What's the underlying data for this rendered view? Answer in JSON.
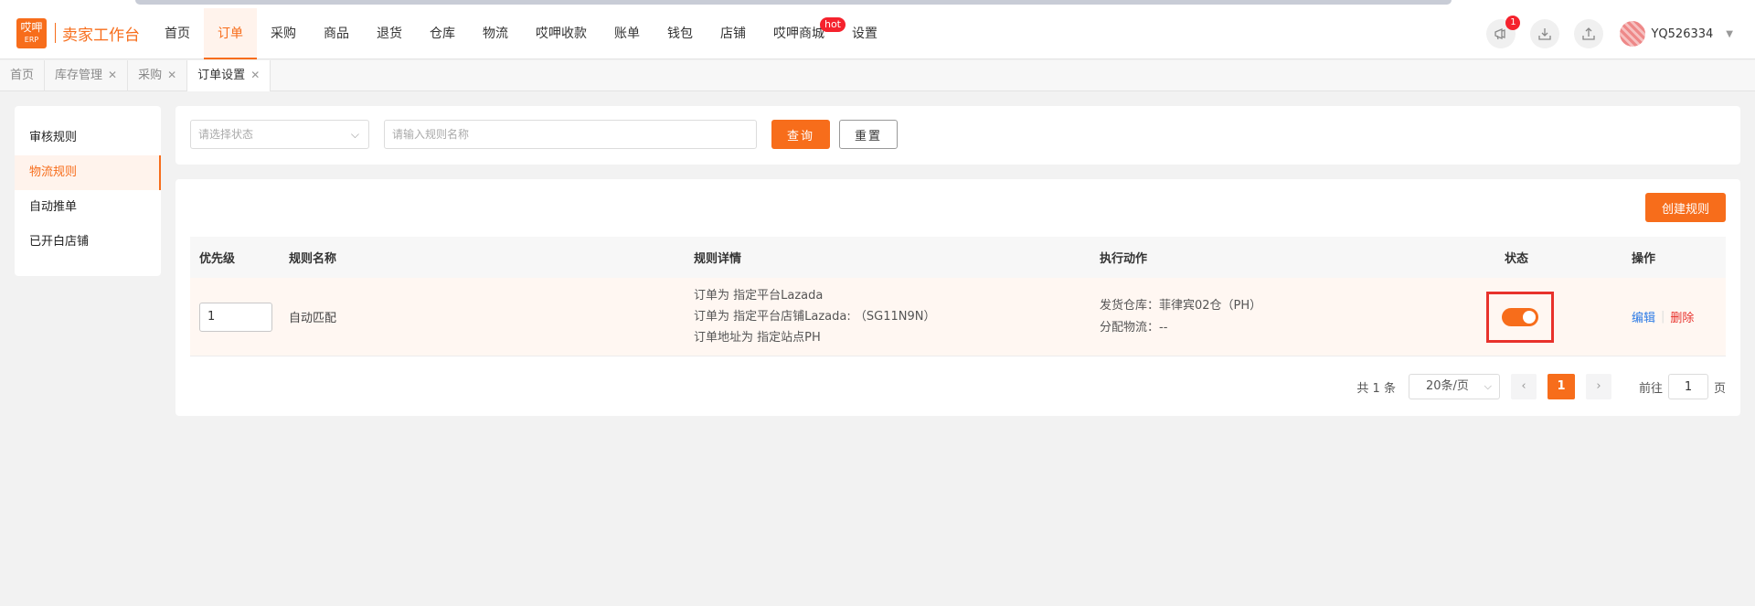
{
  "header": {
    "logo": {
      "line1": "哎呷",
      "line2": "ERP"
    },
    "app_name": "卖家工作台",
    "nav": [
      {
        "label": "首页",
        "active": false
      },
      {
        "label": "订单",
        "active": true
      },
      {
        "label": "采购",
        "active": false
      },
      {
        "label": "商品",
        "active": false
      },
      {
        "label": "退货",
        "active": false
      },
      {
        "label": "仓库",
        "active": false
      },
      {
        "label": "物流",
        "active": false
      },
      {
        "label": "哎呷收款",
        "active": false
      },
      {
        "label": "账单",
        "active": false
      },
      {
        "label": "钱包",
        "active": false
      },
      {
        "label": "店铺",
        "active": false
      },
      {
        "label": "哎呷商城",
        "active": false,
        "badge": "hot"
      },
      {
        "label": "设置",
        "active": false
      }
    ],
    "notification_count": "1",
    "username": "YQ526334",
    "icons": [
      "megaphone-icon",
      "download-icon",
      "upload-icon"
    ]
  },
  "tabs": [
    {
      "label": "首页",
      "closable": false,
      "active": false
    },
    {
      "label": "库存管理",
      "closable": true,
      "active": false
    },
    {
      "label": "采购",
      "closable": true,
      "active": false
    },
    {
      "label": "订单设置",
      "closable": true,
      "active": true
    }
  ],
  "sidebar": {
    "items": [
      {
        "label": "审核规则",
        "active": false
      },
      {
        "label": "物流规则",
        "active": true
      },
      {
        "label": "自动推单",
        "active": false
      },
      {
        "label": "已开白店铺",
        "active": false
      }
    ]
  },
  "filter": {
    "status_placeholder": "请选择状态",
    "name_placeholder": "请输入规则名称",
    "query_label": "查询",
    "reset_label": "重置"
  },
  "main": {
    "create_label": "创建规则",
    "columns": [
      "优先级",
      "规则名称",
      "规则详情",
      "执行动作",
      "状态",
      "操作"
    ],
    "rows": [
      {
        "priority": "1",
        "name": "自动匹配",
        "details": [
          "订单为 指定平台Lazada",
          "订单为 指定平台店铺Lazada: （SG11N9N）",
          "订单地址为 指定站点PH"
        ],
        "actions": [
          "发货仓库：菲律宾02仓（PH）",
          "分配物流：--"
        ],
        "enabled": true,
        "edit_label": "编辑",
        "delete_label": "删除"
      }
    ]
  },
  "pagination": {
    "total_text": "共 1 条",
    "page_size": "20条/页",
    "current_page": "1",
    "goto_label": "前往",
    "goto_value": "1",
    "page_suffix": "页"
  },
  "colors": {
    "accent": "#f76d1b",
    "link": "#2d7be5",
    "danger": "#e8322c"
  }
}
